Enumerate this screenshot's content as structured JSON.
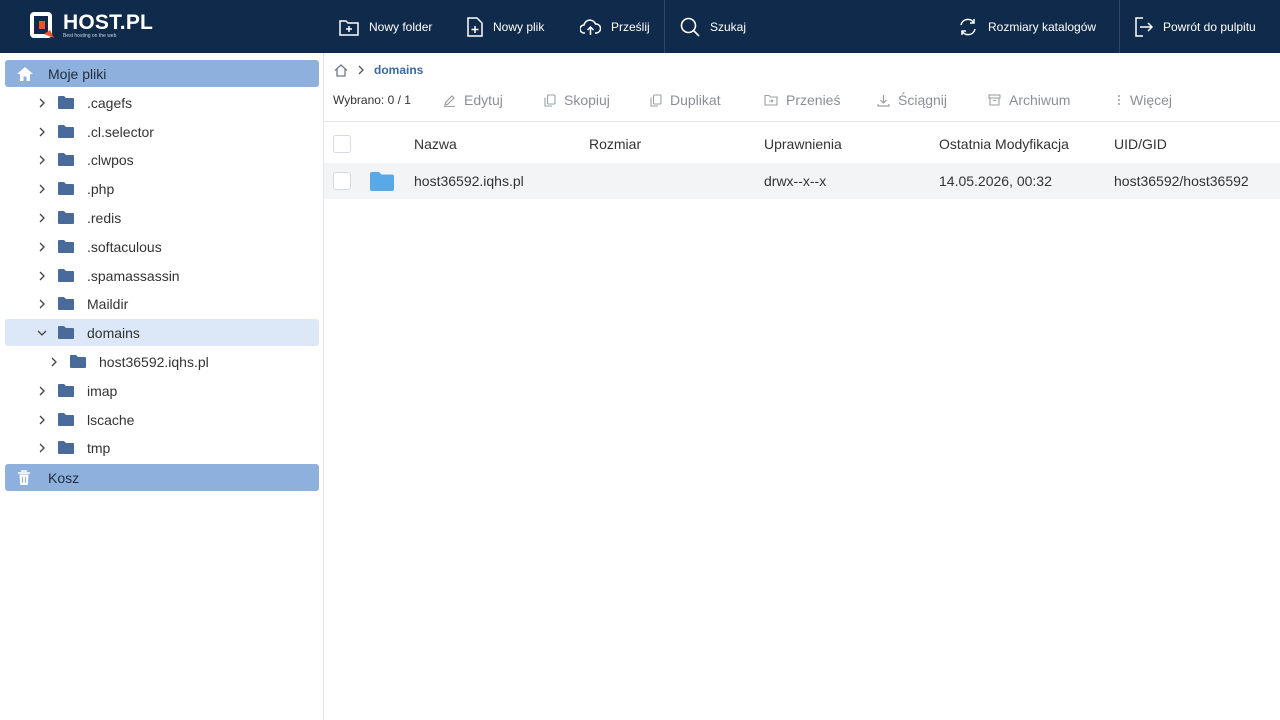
{
  "brand": {
    "name": "HOST.PL",
    "tagline": "Best hosting on the web"
  },
  "toolbar": {
    "new_folder": "Nowy folder",
    "new_file": "Nowy plik",
    "upload": "Prześlij",
    "search": "Szukaj",
    "dir_sizes": "Rozmiary katalogów",
    "back": "Powrót do pulpitu"
  },
  "sidebar": {
    "root_label": "Moje pliki",
    "items": [
      {
        "label": ".cagefs"
      },
      {
        "label": ".cl.selector"
      },
      {
        "label": ".clwpos"
      },
      {
        "label": ".php"
      },
      {
        "label": ".redis"
      },
      {
        "label": ".softaculous"
      },
      {
        "label": ".spamassassin"
      },
      {
        "label": "Maildir"
      },
      {
        "label": "domains"
      },
      {
        "label": "host36592.iqhs.pl"
      },
      {
        "label": "imap"
      },
      {
        "label": "lscache"
      },
      {
        "label": "tmp"
      }
    ],
    "trash_label": "Kosz"
  },
  "breadcrumb": {
    "current": "domains"
  },
  "actions": {
    "selected": "Wybrano: 0 / 1",
    "edit": "Edytuj",
    "copy": "Skopiuj",
    "duplicate": "Duplikat",
    "move": "Przenieś",
    "download": "Ściągnij",
    "archive": "Archiwum",
    "more": "Więcej"
  },
  "table": {
    "headers": {
      "name": "Nazwa",
      "size": "Rozmiar",
      "permissions": "Uprawnienia",
      "modified": "Ostatnia Modyfikacja",
      "uidgid": "UID/GID"
    },
    "rows": [
      {
        "name": "host36592.iqhs.pl",
        "size": "",
        "permissions": "drwx--x--x",
        "modified": "14.05.2026, 00:32",
        "uidgid": "host36592/host36592"
      }
    ]
  },
  "colors": {
    "topbar": "#0f2a4a",
    "sidebar_active": "#8eb0dc",
    "tree_selected": "#dce8f7",
    "folder": "#4a6a9a",
    "folder_light": "#5aa9e6",
    "brand_orange": "#e8532b"
  }
}
